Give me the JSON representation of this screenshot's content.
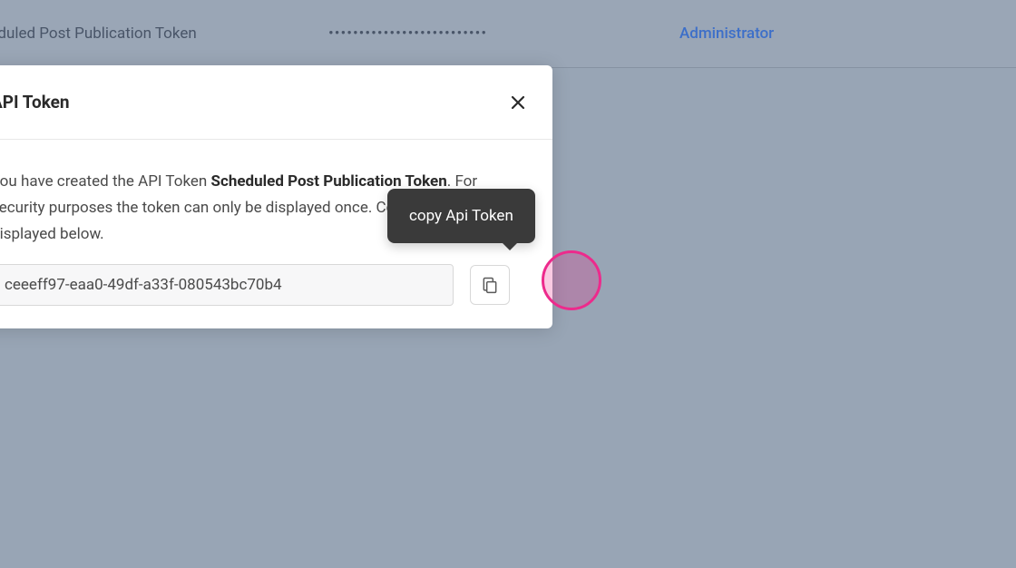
{
  "topbar": {
    "token_name": "Scheduled Post Publication Token",
    "masked": "••••••••••••••••••••••••••",
    "role": "Administrator"
  },
  "modal": {
    "title": "API Token",
    "message_prefix": "You have created the API Token ",
    "message_bold": "Scheduled Post Publication Token",
    "message_suffix": ". For security purposes the token can only be displayed once. Copy the token displayed below.",
    "line1_pre": "You have created the API Token ",
    "line1_bold": "Scheduled Post Publication Token",
    "line1_post": ".",
    "line2": "For security purposes the token can only be displayed once.",
    "line3": "Copy the token displayed below.",
    "token_value": "ceeeff97-eaa0-49df-a33f-080543bc70b4"
  },
  "tooltip": {
    "text": "copy Api Token"
  }
}
